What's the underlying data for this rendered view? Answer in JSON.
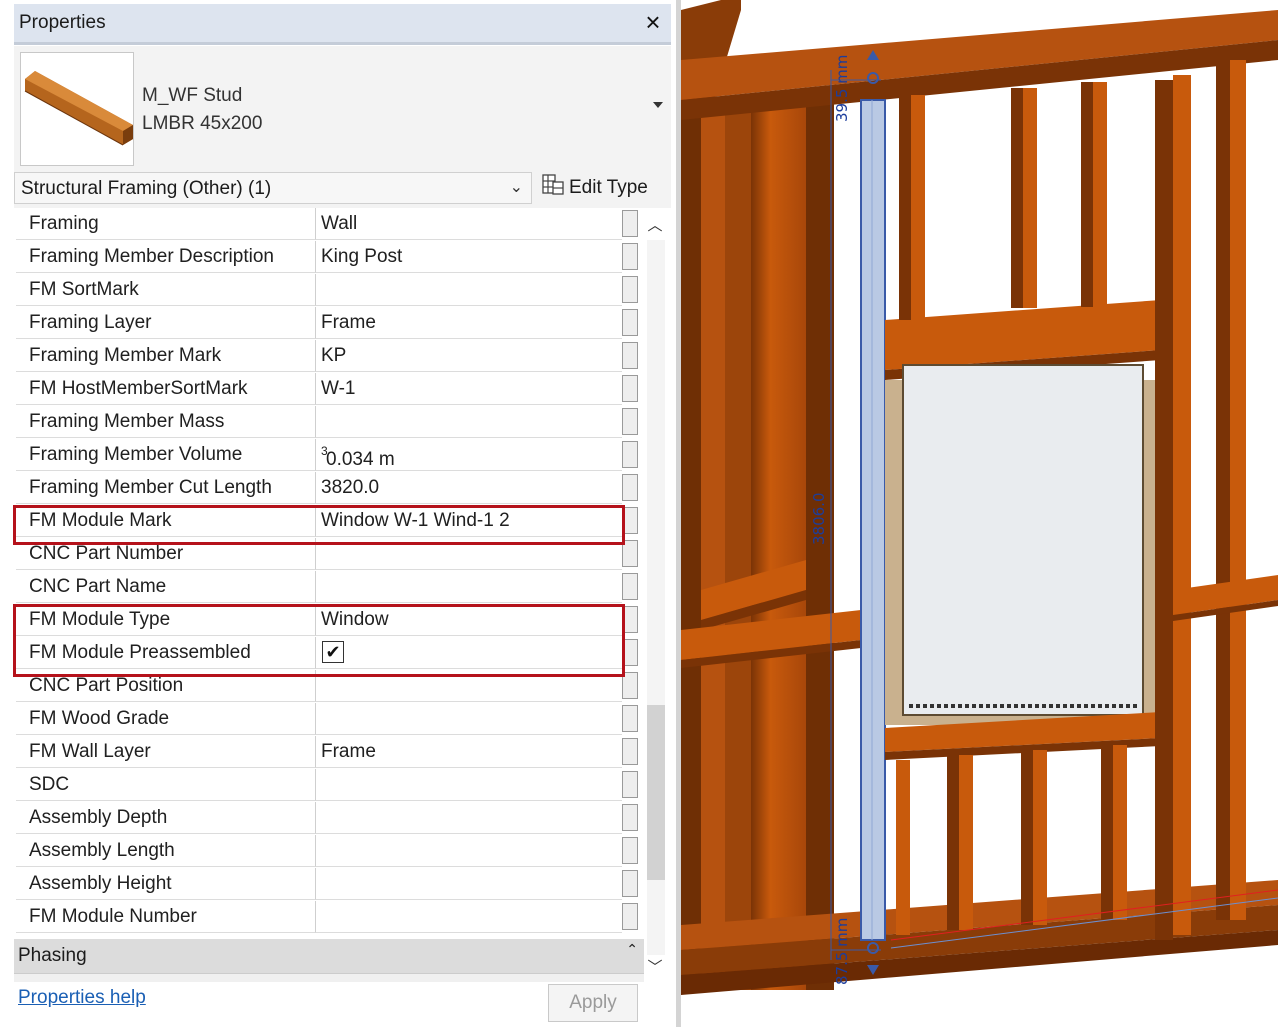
{
  "palette": {
    "title": "Properties",
    "close": "×",
    "type_selector": {
      "family": "M_WF Stud",
      "type": "LMBR 45x200"
    },
    "filter": {
      "label": "Structural Framing (Other) (1)",
      "edit_type": "Edit Type"
    },
    "rows": [
      {
        "name": "Framing",
        "value": "Wall"
      },
      {
        "name": "Framing Member Description",
        "value": "King Post"
      },
      {
        "name": "FM SortMark",
        "value": ""
      },
      {
        "name": "Framing Layer",
        "value": "Frame"
      },
      {
        "name": "Framing Member Mark",
        "value": "KP"
      },
      {
        "name": "FM HostMemberSortMark",
        "value": "W-1"
      },
      {
        "name": "Framing Member Mass",
        "value": ""
      },
      {
        "name": "Framing Member Volume",
        "value": "0.034 m",
        "unit_sup": "3"
      },
      {
        "name": "Framing Member Cut Length",
        "value": "3820.0"
      },
      {
        "name": "FM Module Mark",
        "value": "Window W-1 Wind-1 2"
      },
      {
        "name": "CNC Part Number",
        "value": ""
      },
      {
        "name": "CNC Part Name",
        "value": ""
      },
      {
        "name": "FM Module Type",
        "value": "Window"
      },
      {
        "name": "FM Module Preassembled",
        "value": "",
        "checkbox": true,
        "checked": "✔"
      },
      {
        "name": "CNC Part Position",
        "value": ""
      },
      {
        "name": "FM Wood Grade",
        "value": ""
      },
      {
        "name": "FM Wall Layer",
        "value": "Frame"
      },
      {
        "name": "SDC",
        "value": ""
      },
      {
        "name": "Assembly Depth",
        "value": ""
      },
      {
        "name": "Assembly Length",
        "value": ""
      },
      {
        "name": "Assembly Height",
        "value": ""
      },
      {
        "name": "FM Module Number",
        "value": ""
      }
    ],
    "section": {
      "label": "Phasing",
      "collapse": "⌃"
    },
    "help_link": "Properties help",
    "apply": "Apply"
  },
  "view": {
    "dim_top": "39.5 mm",
    "dim_main": "3806.0",
    "dim_bottom": "87.5 mm"
  },
  "colors": {
    "highlight": "#b5121b",
    "timber": "#c85a0c",
    "timber_dark": "#7a3306",
    "glass": "#eceff2",
    "dimension": "#1c3d9c"
  }
}
